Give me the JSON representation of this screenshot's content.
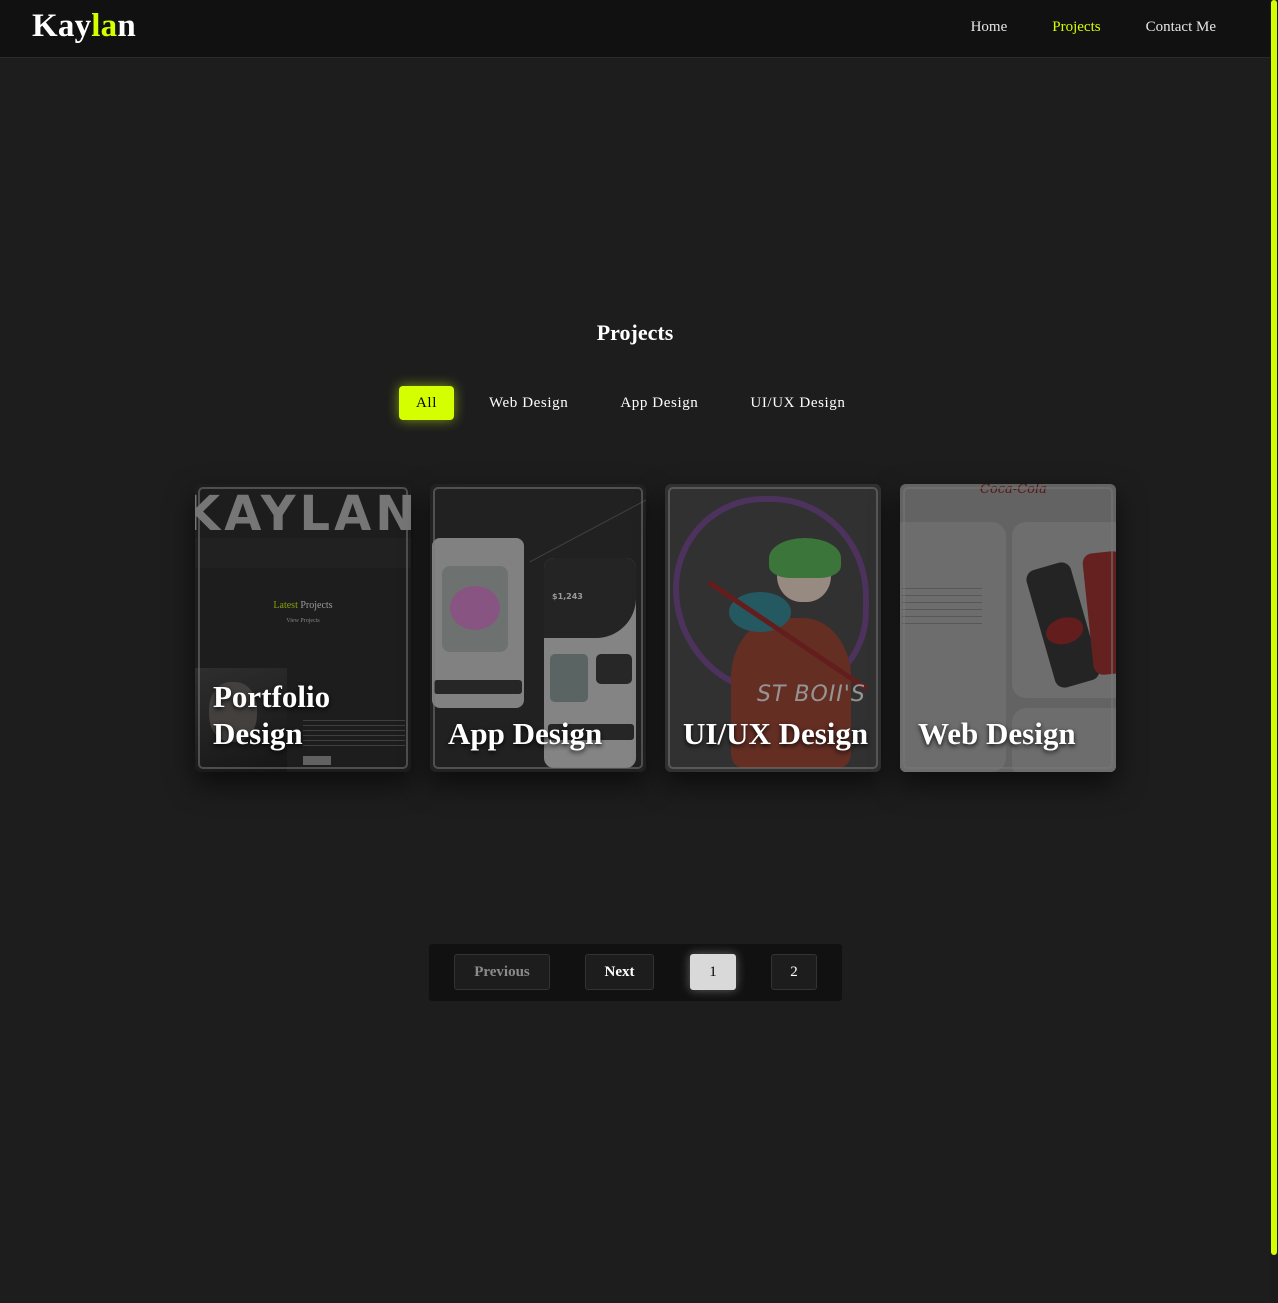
{
  "header": {
    "logo": {
      "part1": "Kay",
      "part2": "la",
      "part3": "n"
    },
    "nav": [
      {
        "label": "Home",
        "active": false
      },
      {
        "label": "Projects",
        "active": true
      },
      {
        "label": "Contact Me",
        "active": false
      }
    ]
  },
  "projects": {
    "title": "Projects",
    "filters": [
      {
        "label": "All",
        "active": true
      },
      {
        "label": "Web Design",
        "active": false
      },
      {
        "label": "App Design",
        "active": false
      },
      {
        "label": "UI/UX Design",
        "active": false
      }
    ],
    "cards": [
      {
        "title": "Portfolio Design",
        "preview": {
          "banner": "KAYLAN",
          "heading_highlight": "Latest",
          "heading_rest": " Projects",
          "link": "View Projects"
        }
      },
      {
        "title": "App Design",
        "preview": {
          "balance": "$1,243"
        }
      },
      {
        "title": "UI/UX Design",
        "preview": {
          "tag": "ST BOII'S"
        }
      },
      {
        "title": "Web Design",
        "preview": {
          "brand": "Coca-Cola"
        }
      }
    ]
  },
  "pagination": {
    "previous": "Previous",
    "next": "Next",
    "pages": [
      "1",
      "2"
    ],
    "current_page": "1"
  },
  "colors": {
    "accent": "#d4ff00",
    "background": "#1d1d1d",
    "header": "#111111"
  }
}
